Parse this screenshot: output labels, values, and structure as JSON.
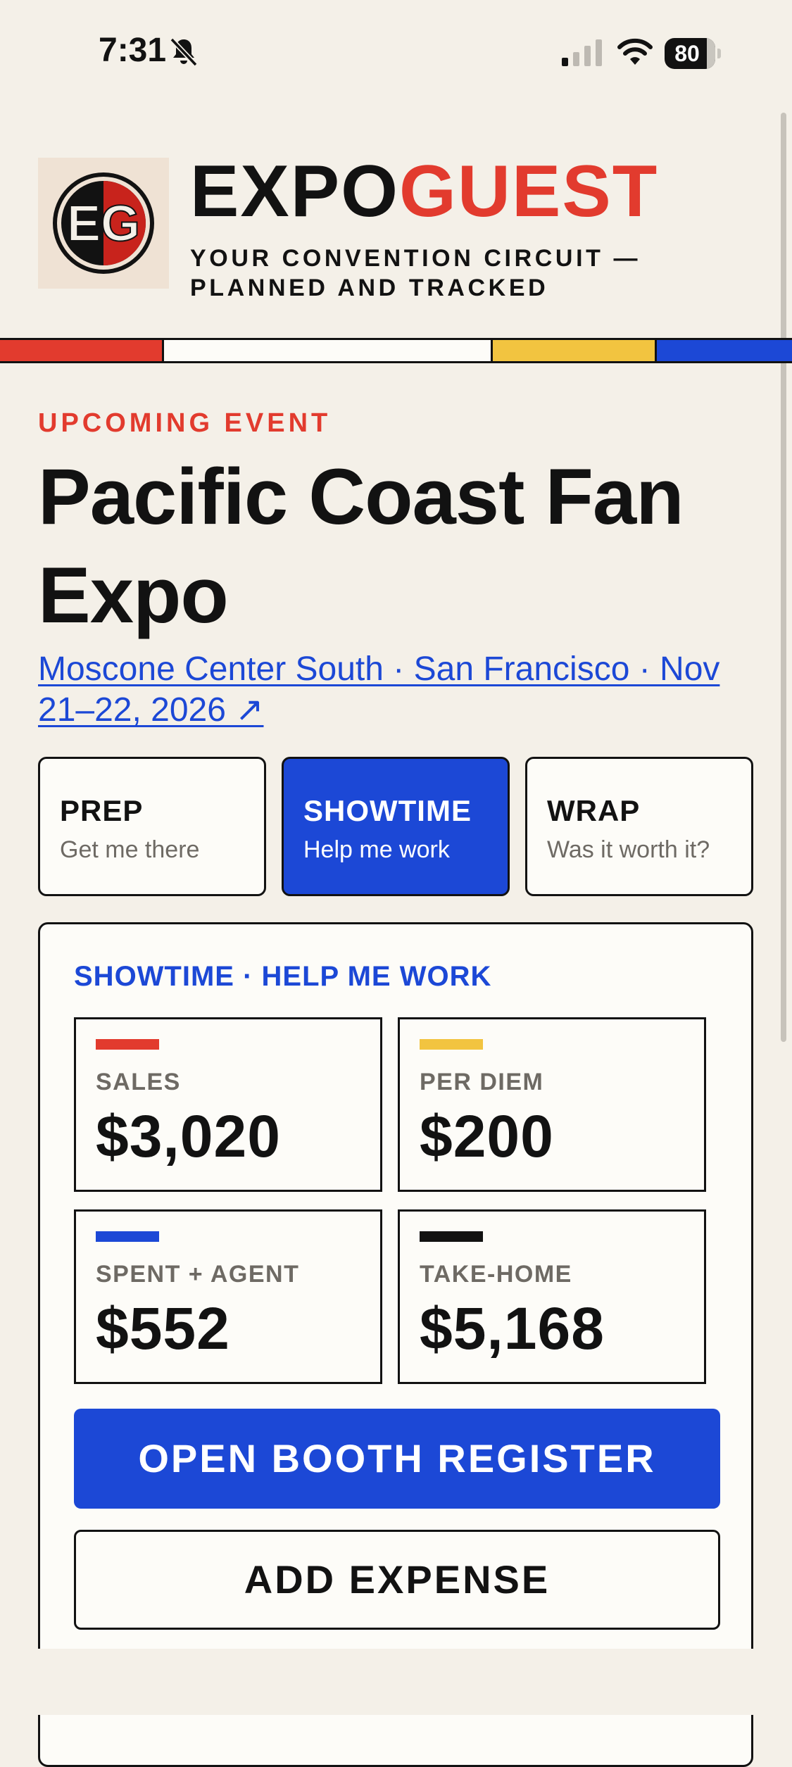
{
  "status_bar": {
    "time": "7:31",
    "battery": "80"
  },
  "header": {
    "brand_part1": "EXPO",
    "brand_part2": "GUEST",
    "logo_text": "EG",
    "tagline": "YOUR CONVENTION CIRCUIT — PLANNED AND TRACKED"
  },
  "colors": {
    "red": "#e23b2e",
    "yellow": "#f2c440",
    "blue": "#1c48d6",
    "ink": "#121212",
    "paper": "#f4f0e8"
  },
  "event": {
    "eyebrow": "UPCOMING EVENT",
    "title": "Pacific Coast Fan Expo",
    "venue_link": "Moscone Center South · San Francisco · Nov 21–22, 2026 ↗"
  },
  "phases": [
    {
      "title": "PREP",
      "subtitle": "Get me there",
      "active": false
    },
    {
      "title": "SHOWTIME",
      "subtitle": "Help me work",
      "active": true
    },
    {
      "title": "WRAP",
      "subtitle": "Was it worth it?",
      "active": false
    }
  ],
  "card": {
    "title": "SHOWTIME · HELP ME WORK",
    "stats": [
      {
        "label": "SALES",
        "value": "$3,020",
        "accent": "#e23b2e"
      },
      {
        "label": "PER DIEM",
        "value": "$200",
        "accent": "#f2c440"
      },
      {
        "label": "SPENT + AGENT",
        "value": "$552",
        "accent": "#1c48d6"
      },
      {
        "label": "TAKE-HOME",
        "value": "$5,168",
        "accent": "#121212"
      }
    ],
    "primary_button": "OPEN BOOTH REGISTER",
    "secondary_button": "ADD EXPENSE"
  }
}
